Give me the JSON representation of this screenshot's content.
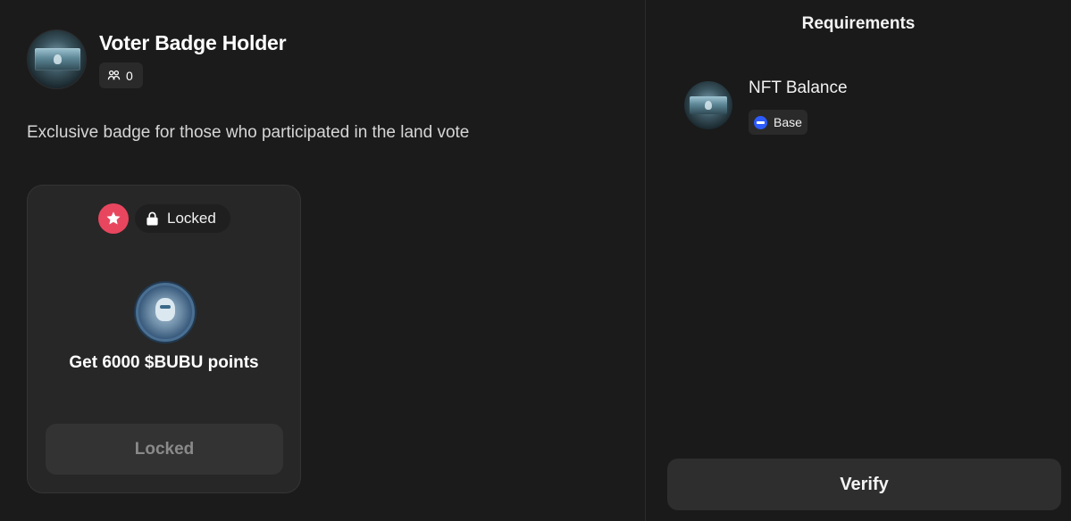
{
  "badge": {
    "title": "Voter Badge Holder",
    "holders_count": "0",
    "description": "Exclusive badge for those who participated in the land vote"
  },
  "reward_card": {
    "status_label": "Locked",
    "reward_text": "Get 6000 $BUBU points",
    "button_label": "Locked",
    "accent_color": "#e8465f"
  },
  "requirements": {
    "heading": "Requirements",
    "items": [
      {
        "name": "NFT Balance",
        "chain": "Base",
        "chain_color": "#2c5bff"
      }
    ],
    "verify_label": "Verify"
  }
}
